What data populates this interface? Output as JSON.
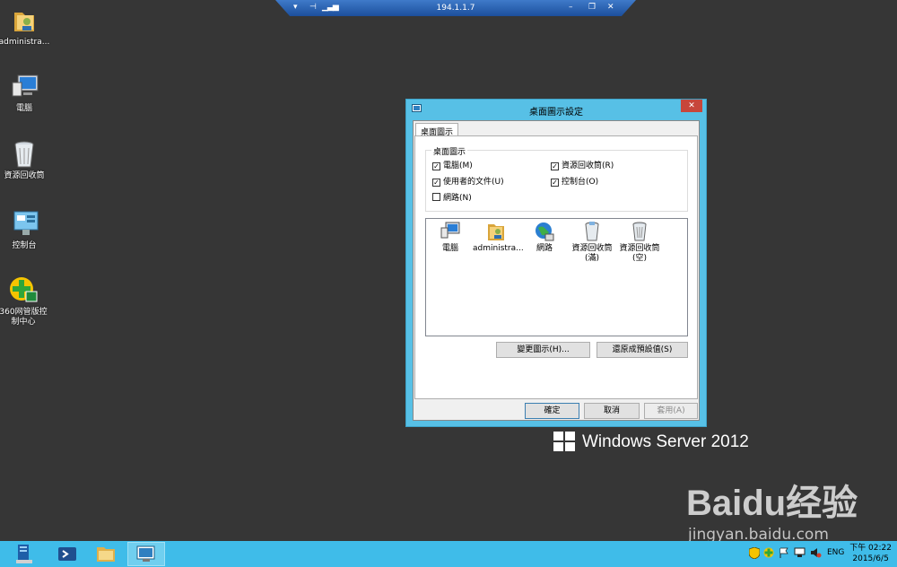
{
  "remote_bar": {
    "title": "194.1.1.7"
  },
  "desktop_icons": [
    {
      "label": "administra..."
    },
    {
      "label": "電腦"
    },
    {
      "label": "資源回收筒"
    },
    {
      "label": "控制台"
    },
    {
      "label": "360网管版控制中心"
    }
  ],
  "dialog": {
    "title": "桌面圖示設定",
    "close_label": "✕",
    "tab": "桌面圖示",
    "group_title": "桌面圖示",
    "checkboxes": [
      {
        "label": "電腦(M)",
        "checked": true
      },
      {
        "label": "資源回收筒(R)",
        "checked": true
      },
      {
        "label": "使用者的文件(U)",
        "checked": true
      },
      {
        "label": "控制台(O)",
        "checked": true
      },
      {
        "label": "網路(N)",
        "checked": false
      }
    ],
    "icon_list": [
      {
        "label": "電腦",
        "icon": "computer-icon"
      },
      {
        "label": "administra...",
        "icon": "user-folder-icon"
      },
      {
        "label": "網路",
        "icon": "network-icon"
      },
      {
        "label": "資源回收筒 (滿)",
        "icon": "recycle-bin-full-icon"
      },
      {
        "label": "資源回收筒 (空)",
        "icon": "recycle-bin-empty-icon"
      }
    ],
    "change_icon_button": "變更圖示(H)...",
    "restore_default_button": "還原成預設值(S)",
    "ok_button": "確定",
    "cancel_button": "取消",
    "apply_button": "套用(A)"
  },
  "watermarks": {
    "windows": "Windows Server 2012",
    "baidu_brand": "Baidu经验",
    "baidu_url": "jingyan.baidu.com"
  },
  "taskbar": {
    "language": "ENG",
    "time": "下午 02:22",
    "date": "2015/6/5"
  },
  "colors": {
    "desktop": "#363636",
    "taskbar": "#3fbce9",
    "dialog_frame": "#57c0e6",
    "close_button": "#c7463b"
  }
}
